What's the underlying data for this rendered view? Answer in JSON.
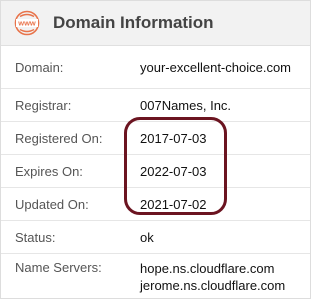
{
  "header": {
    "icon": "www-globe-icon",
    "icon_text": "www",
    "title": "Domain Information",
    "accent_color": "#e8734a"
  },
  "rows": [
    {
      "label": "Domain:",
      "value": "your-excellent-choice.com"
    },
    {
      "label": "Registrar:",
      "value": "007Names, Inc."
    },
    {
      "label": "Registered On:",
      "value": "2017-07-03"
    },
    {
      "label": "Expires On:",
      "value": "2022-07-03"
    },
    {
      "label": "Updated On:",
      "value": "2021-07-02"
    },
    {
      "label": "Status:",
      "value": "ok"
    },
    {
      "label": "Name Servers:",
      "values": [
        "hope.ns.cloudflare.com",
        "jerome.ns.cloudflare.com"
      ]
    }
  ],
  "highlight_color": "#6b1420"
}
